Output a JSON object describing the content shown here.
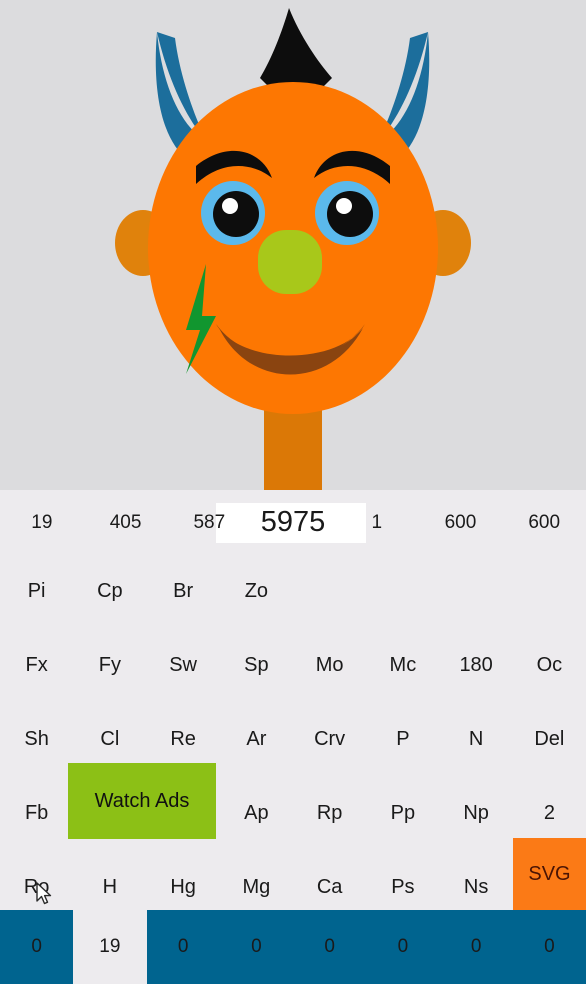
{
  "colors": {
    "background": "#dcdcde",
    "panel": "#edebee",
    "head": "#fd7702",
    "neck": "#db7806",
    "horn_blue": "#1c6e9c",
    "horn_black": "#0d0d0d",
    "eye_ring": "#5bb9ec",
    "nose": "#a8c81a",
    "mouth": "#8a4410",
    "bolt": "#11962f",
    "accent_green": "#8cc016",
    "accent_orange": "#fb7a16",
    "status_blue": "#00648f",
    "display_bg": "#ffffff"
  },
  "mascot": {
    "name": "devil-face-mascot",
    "description": "orange monster face with blue horns, black top horn, green nose, lightning bolt cheek"
  },
  "display_row": {
    "cells": [
      {
        "label": "19",
        "highlighted": false
      },
      {
        "label": "405",
        "highlighted": false
      },
      {
        "label": "587",
        "highlighted": false
      },
      {
        "label": "5975",
        "highlighted": true
      },
      {
        "label": "1",
        "highlighted": false
      },
      {
        "label": "600",
        "highlighted": false
      },
      {
        "label": "600",
        "highlighted": false
      }
    ]
  },
  "keypad": {
    "rows": [
      {
        "name": "row-pi",
        "keys": [
          {
            "label": "Pi"
          },
          {
            "label": "Cp"
          },
          {
            "label": "Br"
          },
          {
            "label": "Zo"
          },
          {
            "label": ""
          },
          {
            "label": ""
          },
          {
            "label": ""
          },
          {
            "label": ""
          }
        ]
      },
      {
        "name": "row-fx",
        "keys": [
          {
            "label": "Fx"
          },
          {
            "label": "Fy"
          },
          {
            "label": "Sw"
          },
          {
            "label": "Sp"
          },
          {
            "label": "Mo"
          },
          {
            "label": "Mc"
          },
          {
            "label": "180"
          },
          {
            "label": "Oc"
          }
        ]
      },
      {
        "name": "row-sh",
        "keys": [
          {
            "label": "Sh"
          },
          {
            "label": "Cl"
          },
          {
            "label": "Re"
          },
          {
            "label": "Ar"
          },
          {
            "label": "Crv"
          },
          {
            "label": "P"
          },
          {
            "label": "N"
          },
          {
            "label": "Del"
          }
        ]
      },
      {
        "name": "row-fb",
        "keys": [
          {
            "label": "Fb"
          },
          {
            "label": ""
          },
          {
            "label": ""
          },
          {
            "label": "Ap"
          },
          {
            "label": "Rp"
          },
          {
            "label": "Pp"
          },
          {
            "label": "Np"
          },
          {
            "label": "2"
          }
        ]
      },
      {
        "name": "row-ro",
        "keys": [
          {
            "label": "Ro"
          },
          {
            "label": "H"
          },
          {
            "label": "Hg"
          },
          {
            "label": "Mg"
          },
          {
            "label": "Ca"
          },
          {
            "label": "Ps"
          },
          {
            "label": "Ns"
          },
          {
            "label": ""
          }
        ]
      }
    ],
    "watch_ads_label": "Watch Ads",
    "svg_label": "SVG"
  },
  "status_bar": {
    "cells": [
      {
        "label": "0",
        "style": "blue"
      },
      {
        "label": "19",
        "style": "light"
      },
      {
        "label": "0",
        "style": "blue"
      },
      {
        "label": "0",
        "style": "blue"
      },
      {
        "label": "0",
        "style": "blue"
      },
      {
        "label": "0",
        "style": "blue"
      },
      {
        "label": "0",
        "style": "blue"
      },
      {
        "label": "0",
        "style": "blue"
      }
    ]
  }
}
